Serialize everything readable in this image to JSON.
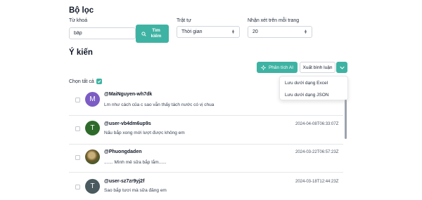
{
  "filter": {
    "title": "Bộ lọc",
    "keyword_label": "Từ khoá",
    "keyword_value": "bắp",
    "search_label": "Tìm kiếm",
    "order_label": "Trật tự",
    "order_value": "Thời gian",
    "per_page_label": "Nhận xét trên mỗi trang",
    "per_page_value": "20"
  },
  "opinions": {
    "title": "Ý kiến",
    "ai_button": "Phân tích AI",
    "export_button": "Xuất bình luận",
    "select_all": "Chọn tất cả",
    "export_menu": [
      "Lưu dưới dạng Excel",
      "Lưu dưới dạng JSON"
    ],
    "comments": [
      {
        "user": "@MaiNguyen-wh7dk",
        "text": "Lm như cách của c sao vẫn thấy tách nước có vị chua",
        "time": "",
        "avatar_letter": "M",
        "avatar_color": "#7c5cc4"
      },
      {
        "user": "@user-vb4dm6up9s",
        "text": "Nấu bắp xong mới lượt được không em",
        "time": "2024-04-08T06:33:07Z",
        "avatar_letter": "T",
        "avatar_color": "#2e6b2a"
      },
      {
        "user": "@Phuongdaden",
        "text": "....... Mình mê sữa bắp lắm......",
        "time": "2024-03-22T06:57:23Z",
        "avatar_letter": "",
        "avatar_color": "#8b7a3e"
      },
      {
        "user": "@user-sz7zr9yj2f",
        "text": "Sao bắp tươi mà sữa đăng em",
        "time": "2024-03-18T12:44:23Z",
        "avatar_letter": "T",
        "avatar_color": "#4a5a5f"
      }
    ]
  }
}
